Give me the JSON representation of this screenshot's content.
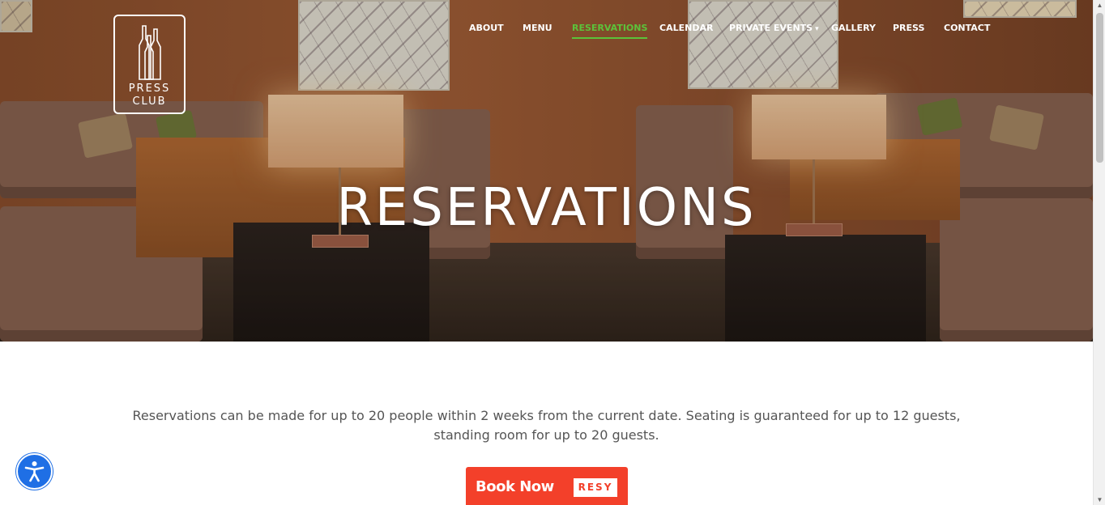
{
  "logo": {
    "line1": "PRESS",
    "line2": "CLUB",
    "icon": "wine-bottles-icon"
  },
  "nav": {
    "items": [
      {
        "label": "ABOUT"
      },
      {
        "label": "MENU"
      },
      {
        "label": "RESERVATIONS",
        "active": true
      },
      {
        "label": "CALENDAR"
      },
      {
        "label": "PRIVATE EVENTS",
        "has_dropdown": true
      },
      {
        "label": "GALLERY"
      },
      {
        "label": "PRESS"
      },
      {
        "label": "CONTACT"
      }
    ],
    "active_color": "#5cc23a"
  },
  "hero": {
    "title": "RESERVATIONS"
  },
  "content": {
    "intro": "Reservations can be made for up to 20 people within 2 weeks from the current date. Seating is guaranteed for up to 12 guests, standing room for up to 20 guests."
  },
  "book_button": {
    "label": "Book Now",
    "badge": "RESY",
    "color": "#f3402a"
  },
  "accessibility_button": {
    "icon": "accessibility-icon",
    "color": "#1f6fe5"
  },
  "scrollbar": {
    "up_arrow": "▲",
    "down_arrow": "▼"
  }
}
